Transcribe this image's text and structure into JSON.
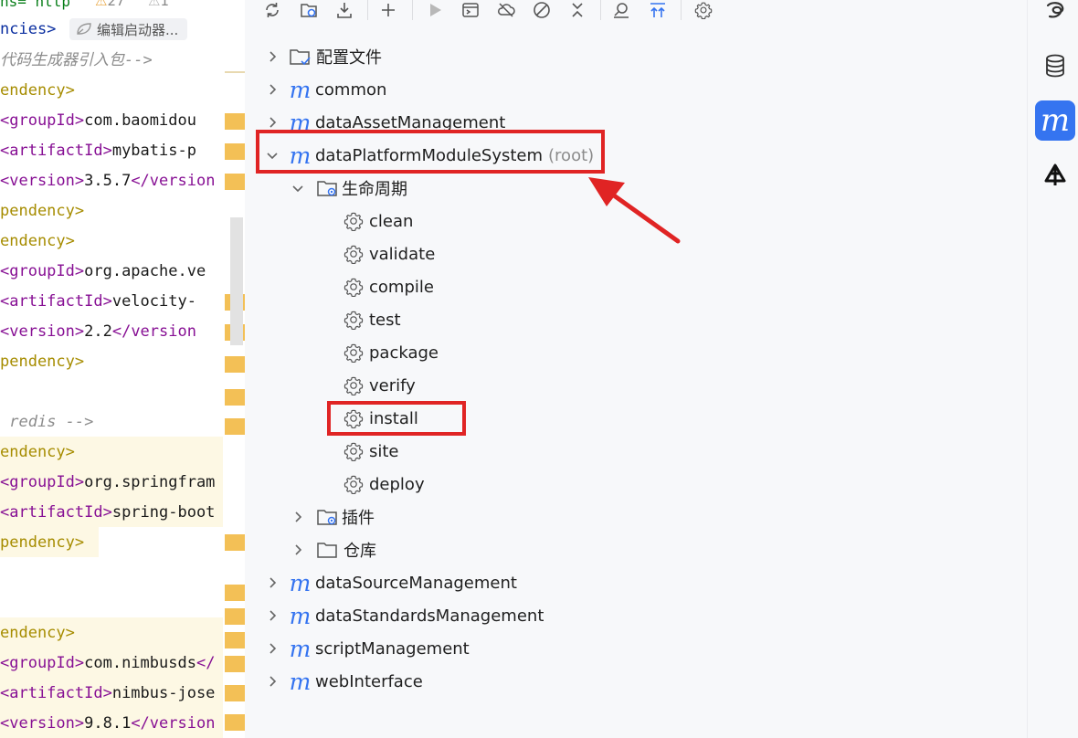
{
  "editor": {
    "top_fragment": "ns= http",
    "warnings_count": "27",
    "weak_warnings_count": "1",
    "breadcrumb_text": "ncies>",
    "breadcrumb_pill": "编辑启动器...",
    "lines": [
      {
        "comment": "代码生成器引入包-->"
      },
      {
        "dep": "endency>"
      },
      {
        "tag_open": "<groupId>",
        "value": "com.baomidou"
      },
      {
        "tag_open": "<artifactId>",
        "value": "mybatis-p"
      },
      {
        "tag_open": "<version>",
        "value": "3.5.7",
        "tag_close": "</version"
      },
      {
        "dep": "pendency>"
      },
      {
        "dep": "endency>"
      },
      {
        "tag_open": "<groupId>",
        "value": "org.apache.ve"
      },
      {
        "tag_open": "<artifactId>",
        "value": "velocity-"
      },
      {
        "tag_open": "<version>",
        "value": "2.2",
        "tag_close": "</version"
      },
      {
        "dep": "pendency>"
      },
      {
        "comment": " redis -->"
      },
      {
        "dep": "endency>"
      },
      {
        "tag_open": "<groupId>",
        "value": "org.springfram"
      },
      {
        "tag_open": "<artifactId>",
        "value": "spring-boot"
      },
      {
        "dep": "pendency>"
      },
      {
        "dep": "endency>"
      },
      {
        "tag_open": "<groupId>",
        "value": "com.nimbusds",
        "tag_close": "</"
      },
      {
        "tag_open": "<artifactId>",
        "value": "nimbus-jose"
      },
      {
        "tag_open": "<version>",
        "value": "9.8.1",
        "tag_close": "</version"
      }
    ]
  },
  "toolbar": {
    "icons": [
      "reload-icon",
      "reimport-icon",
      "download-icon",
      "add-icon",
      "run-icon",
      "run-config-icon",
      "offline-icon",
      "skip-tests-icon",
      "collapse-icon",
      "analyze-icon",
      "show-dependencies-icon",
      "settings-icon"
    ]
  },
  "tree": {
    "config_folder": "配置文件",
    "modules_before": [
      "common",
      "dataAssetManagement"
    ],
    "root_module": "dataPlatformModuleSystem",
    "root_suffix": "(root)",
    "lifecycle_label": "生命周期",
    "lifecycle_goals": [
      "clean",
      "validate",
      "compile",
      "test",
      "package",
      "verify",
      "install",
      "site",
      "deploy"
    ],
    "plugins_label": "插件",
    "repositories_label": "仓库",
    "modules_after": [
      "dataSourceManagement",
      "dataStandardsManagement",
      "scriptManagement",
      "webInterface"
    ]
  },
  "strip": {
    "icons": [
      "ai-assistant-icon",
      "database-icon",
      "maven-icon",
      "plugin-icon"
    ],
    "active": "maven-icon",
    "maven_glyph": "m"
  },
  "colors": {
    "accent": "#3574f0",
    "highlight_box": "#e02424",
    "tag": "#871094",
    "dependency": "#a68c00"
  }
}
